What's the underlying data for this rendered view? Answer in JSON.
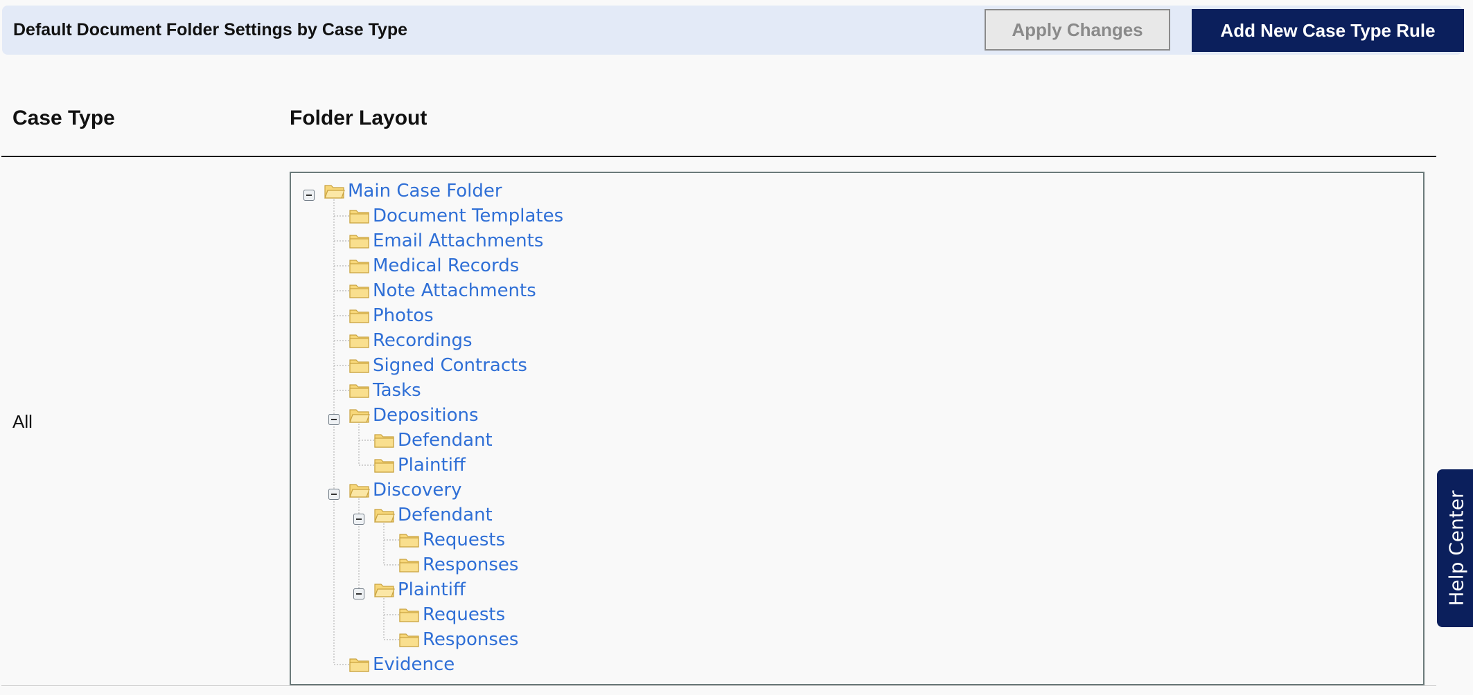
{
  "header": {
    "title": "Default Document Folder Settings by Case Type",
    "apply_label": "Apply Changes",
    "add_label": "Add New Case Type Rule"
  },
  "columns": {
    "case_type": "Case Type",
    "folder_layout": "Folder Layout"
  },
  "row": {
    "case_type": "All"
  },
  "tree": [
    {
      "label": "Main Case Folder",
      "depth": 0,
      "expanded": true
    },
    {
      "label": "Document Templates",
      "depth": 1,
      "expanded": null
    },
    {
      "label": "Email Attachments",
      "depth": 1,
      "expanded": null
    },
    {
      "label": "Medical Records",
      "depth": 1,
      "expanded": null
    },
    {
      "label": "Note Attachments",
      "depth": 1,
      "expanded": null
    },
    {
      "label": "Photos",
      "depth": 1,
      "expanded": null
    },
    {
      "label": "Recordings",
      "depth": 1,
      "expanded": null
    },
    {
      "label": "Signed Contracts",
      "depth": 1,
      "expanded": null
    },
    {
      "label": "Tasks",
      "depth": 1,
      "expanded": null
    },
    {
      "label": "Depositions",
      "depth": 1,
      "expanded": true
    },
    {
      "label": "Defendant",
      "depth": 2,
      "expanded": null
    },
    {
      "label": "Plaintiff",
      "depth": 2,
      "expanded": null
    },
    {
      "label": "Discovery",
      "depth": 1,
      "expanded": true
    },
    {
      "label": "Defendant",
      "depth": 2,
      "expanded": true
    },
    {
      "label": "Requests",
      "depth": 3,
      "expanded": null
    },
    {
      "label": "Responses",
      "depth": 3,
      "expanded": null
    },
    {
      "label": "Plaintiff",
      "depth": 2,
      "expanded": true
    },
    {
      "label": "Requests",
      "depth": 3,
      "expanded": null
    },
    {
      "label": "Responses",
      "depth": 3,
      "expanded": null
    },
    {
      "label": "Evidence",
      "depth": 1,
      "expanded": null
    }
  ],
  "help": {
    "label": "Help Center"
  },
  "colors": {
    "navy": "#0b1f5c",
    "header_bg": "#e3eaf7",
    "link": "#2f6fd6",
    "folder_fill": "#f7d77a",
    "folder_stroke": "#c9a23e"
  }
}
